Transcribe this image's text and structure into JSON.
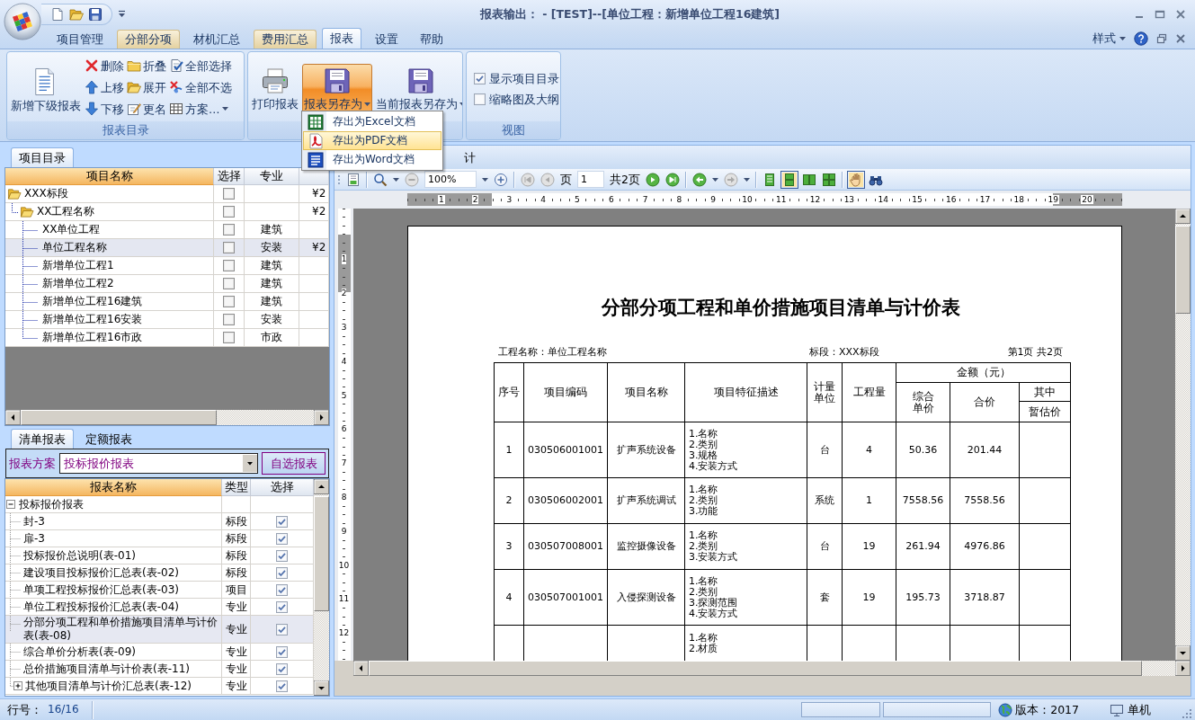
{
  "window": {
    "title": "报表输出： - [TEST]--[单位工程：新增单位工程16建筑]"
  },
  "ribbon_tabs": [
    {
      "label": "项目管理",
      "selected": false,
      "highlighted": false
    },
    {
      "label": "分部分项",
      "selected": false,
      "highlighted": true
    },
    {
      "label": "材机汇总",
      "selected": false,
      "highlighted": false
    },
    {
      "label": "费用汇总",
      "selected": false,
      "highlighted": true
    },
    {
      "label": "报表",
      "selected": true,
      "highlighted": false
    },
    {
      "label": "设置",
      "selected": false,
      "highlighted": false
    },
    {
      "label": "帮助",
      "selected": false,
      "highlighted": false
    }
  ],
  "ribbon_right": {
    "style_menu": "样式"
  },
  "catalog_group": {
    "label": "报表目录",
    "large_button": "新增下级报表",
    "small_buttons": [
      {
        "label": "删除"
      },
      {
        "label": "上移"
      },
      {
        "label": "下移"
      },
      {
        "label": "折叠"
      },
      {
        "label": "展开"
      },
      {
        "label": "更名"
      },
      {
        "label": "全部选择"
      },
      {
        "label": "全部不选"
      },
      {
        "label": "方案…",
        "dropdown": true
      }
    ]
  },
  "output_group": {
    "buttons": [
      {
        "label": "打印报表",
        "selected": false
      },
      {
        "label": "报表另存为",
        "dropdown": true,
        "selected": true
      },
      {
        "label": "当前报表另存为",
        "dropdown": true,
        "selected": false
      }
    ]
  },
  "view_group": {
    "label": "视图",
    "options": [
      {
        "label": "显示项目目录",
        "checked": true
      },
      {
        "label": "缩略图及大纲",
        "checked": false
      }
    ]
  },
  "save_menu": [
    {
      "label": "存出为Excel文档",
      "selected": false
    },
    {
      "label": "存出为PDF文档",
      "selected": true
    },
    {
      "label": "存出为Word文档",
      "selected": false
    }
  ],
  "project_panel": {
    "tab": "项目目录",
    "columns": [
      "项目名称",
      "选择",
      "专业"
    ],
    "tree": [
      {
        "name": "XXX标段",
        "checked": false,
        "column_4": "¥2",
        "selected": false,
        "expanded": true,
        "children": [
          {
            "name": "XX工程名称",
            "checked": false,
            "column_4": "¥2",
            "selected": false,
            "expanded": true,
            "children": [
              {
                "name": "XX单位工程",
                "checked": false,
                "specialty": "建筑",
                "selected": false
              },
              {
                "name": "单位工程名称",
                "checked": false,
                "specialty": "安装",
                "column_4": "¥2",
                "selected": true
              },
              {
                "name": "新增单位工程1",
                "checked": false,
                "specialty": "建筑",
                "selected": false
              },
              {
                "name": "新增单位工程2",
                "checked": false,
                "specialty": "建筑",
                "selected": false
              },
              {
                "name": "新增单位工程16建筑",
                "checked": false,
                "specialty": "建筑",
                "selected": false
              },
              {
                "name": "新增单位工程16安装",
                "checked": false,
                "specialty": "安装",
                "selected": false
              },
              {
                "name": "新增单位工程16市政",
                "checked": false,
                "specialty": "市政",
                "selected": false
              }
            ]
          }
        ]
      }
    ]
  },
  "report_panel": {
    "tabs": [
      {
        "label": "清单报表",
        "selected": true
      },
      {
        "label": "定额报表",
        "selected": false
      }
    ],
    "scheme_label": "报表方案",
    "scheme": "投标报价报表",
    "custom_button": "自选报表",
    "columns": [
      "报表名称",
      "类型",
      "选择"
    ],
    "tree": [
      {
        "name": "投标报价报表",
        "expanded": true,
        "selected": false,
        "children": [
          {
            "name": "封-3",
            "type": "标段",
            "checked": true,
            "selected": false
          },
          {
            "name": "扉-3",
            "type": "标段",
            "checked": true,
            "selected": false
          },
          {
            "name": "投标报价总说明(表-01)",
            "type": "标段",
            "checked": true,
            "selected": false
          },
          {
            "name": "建设项目投标报价汇总表(表-02)",
            "type": "标段",
            "checked": true,
            "selected": false
          },
          {
            "name": "单项工程投标报价汇总表(表-03)",
            "type": "项目",
            "checked": true,
            "selected": false
          },
          {
            "name": "单位工程投标报价汇总表(表-04)",
            "type": "专业",
            "checked": true,
            "selected": false
          },
          {
            "name": "分部分项工程和单价措施项目清单与计价表(表-08)",
            "type": "专业",
            "checked": true,
            "selected": true
          },
          {
            "name": "综合单价分析表(表-09)",
            "type": "专业",
            "checked": true,
            "selected": false
          },
          {
            "name": "总价措施项目清单与计价表(表-11)",
            "type": "专业",
            "checked": true,
            "selected": false
          },
          {
            "name": "其他项目清单与计价汇总表(表-12)",
            "type": "专业",
            "checked": true,
            "selected": false,
            "expanded": false
          }
        ]
      }
    ]
  },
  "preview": {
    "tab": "计",
    "toolbar": {
      "zoom": "100%",
      "page_label": "页",
      "page": "1",
      "page_count": "共2页",
      "view_modes": [
        {
          "selected": false
        },
        {
          "selected": true
        },
        {
          "selected": false
        },
        {
          "selected": false
        }
      ],
      "hand_tool": {
        "selected": true
      }
    },
    "h_ruler": [
      "1",
      "2",
      "3",
      "4",
      "5",
      "6",
      "7",
      "8",
      "9",
      "10",
      "11",
      "12",
      "13",
      "14",
      "15",
      "16",
      "17",
      "18",
      "19",
      "20"
    ],
    "v_ruler": [
      "1",
      "2",
      "3",
      "4",
      "5",
      "6",
      "7",
      "8",
      "9",
      "10",
      "11",
      "12"
    ],
    "document": {
      "title": "分部分项工程和单价措施项目清单与计价表",
      "project": "工程名称：单位工程名称",
      "section": "标段：XXX标段",
      "page_info": "第1页 共2页",
      "columns": [
        "序号",
        "项目编码",
        "项目名称",
        "项目特征描述",
        "计量单位",
        "工程量"
      ],
      "amount_header": "金额（元）",
      "amount_columns": [
        "综合单价",
        "合价"
      ],
      "of_which": "其中",
      "of_which_columns": [
        "暂估价"
      ],
      "rows": [
        {
          "no": "1",
          "code": "030506001001",
          "name": "扩声系统设备",
          "features": [
            "1.名称",
            "2.类别",
            "3.规格",
            "4.安装方式"
          ],
          "unit": "台",
          "quantity": "4",
          "unit_price": "50.36",
          "total": "201.44"
        },
        {
          "no": "2",
          "code": "030506002001",
          "name": "扩声系统调试",
          "features": [
            "1.名称",
            "2.类别",
            "3.功能"
          ],
          "unit": "系统",
          "quantity": "1",
          "unit_price": "7558.56",
          "total": "7558.56"
        },
        {
          "no": "3",
          "code": "030507008001",
          "name": "监控摄像设备",
          "features": [
            "1.名称",
            "2.类别",
            "3.安装方式"
          ],
          "unit": "台",
          "quantity": "19",
          "unit_price": "261.94",
          "total": "4976.86"
        },
        {
          "no": "4",
          "code": "030507001001",
          "name": "入侵探测设备",
          "features": [
            "1.名称",
            "2.类别",
            "3.探测范围",
            "4.安装方式"
          ],
          "unit": "套",
          "quantity": "19",
          "unit_price": "195.73",
          "total": "3718.87"
        },
        {
          "features": [
            "1.名称",
            "2.材质"
          ]
        }
      ]
    }
  },
  "status_bar": {
    "row_label": "行号：",
    "row_value": "16/16",
    "version": "版本：2017",
    "mode": "单机"
  }
}
